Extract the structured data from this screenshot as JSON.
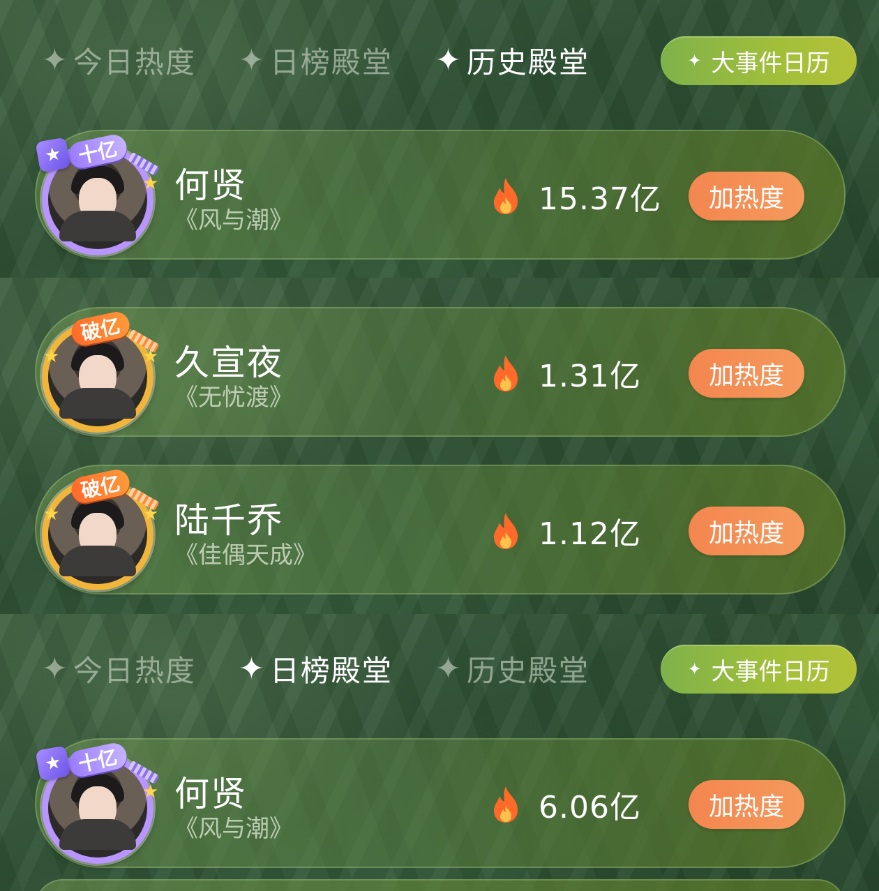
{
  "panel1": {
    "tabs": [
      {
        "label": "今日热度",
        "active": false
      },
      {
        "label": "日榜殿堂",
        "active": false
      },
      {
        "label": "历史殿堂",
        "active": true
      }
    ],
    "event_button": "大事件日历",
    "cards": [
      {
        "badge": "十亿",
        "name": "何贤",
        "drama": "《风与潮》",
        "heat": "15.37亿",
        "boost": "加热度"
      }
    ]
  },
  "panel2": {
    "cards": [
      {
        "badge": "破亿",
        "name": "久宣夜",
        "drama": "《无忧渡》",
        "heat": "1.31亿",
        "boost": "加热度"
      },
      {
        "badge": "破亿",
        "name": "陆千乔",
        "drama": "《佳偶天成》",
        "heat": "1.12亿",
        "boost": "加热度"
      }
    ]
  },
  "panel3": {
    "tabs": [
      {
        "label": "今日热度",
        "active": false
      },
      {
        "label": "日榜殿堂",
        "active": true
      },
      {
        "label": "历史殿堂",
        "active": false
      }
    ],
    "event_button": "大事件日历",
    "cards": [
      {
        "badge": "十亿",
        "name": "何贤",
        "drama": "《风与潮》",
        "heat": "6.06亿",
        "boost": "加热度"
      }
    ]
  },
  "icons": {
    "tab_star": "sparkle-icon",
    "heat": "flame-icon",
    "badge_purple": "trophy-icon"
  },
  "colors": {
    "boost_button": "#f3864f",
    "event_button": "#a2bf3a",
    "badge_purple": "#b895ff",
    "badge_gold": "#f0b53a",
    "flame": "#ff6a2a"
  }
}
